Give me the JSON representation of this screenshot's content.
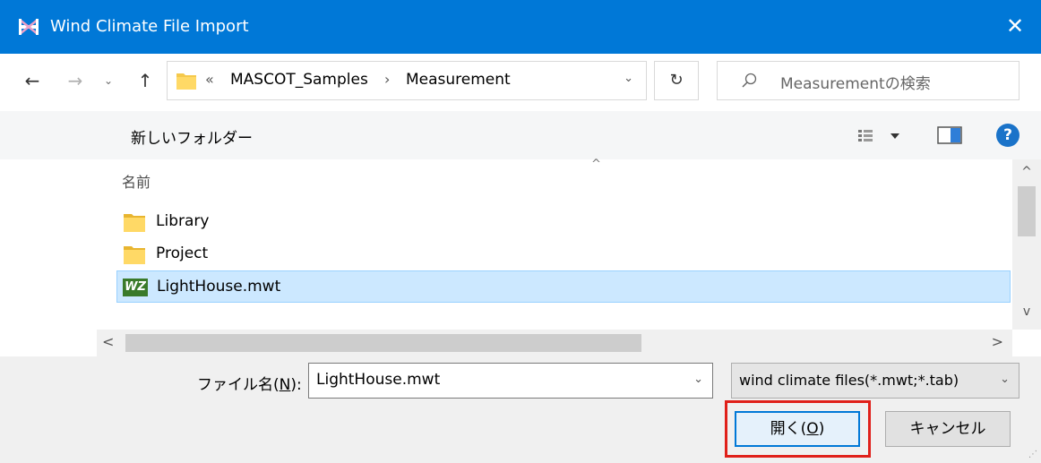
{
  "window": {
    "title": "Wind Climate File Import",
    "close_glyph": "✕"
  },
  "nav": {
    "back_glyph": "←",
    "forward_glyph": "→",
    "recent_glyph": "⌄",
    "up_glyph": "↑"
  },
  "address": {
    "chevron": "«",
    "crumbs": [
      "MASCOT_Samples",
      "Measurement"
    ],
    "separator": "›",
    "dropdown_glyph": "⌄"
  },
  "refresh_glyph": "↻",
  "search": {
    "placeholder": "Measurementの検索"
  },
  "toolbar": {
    "new_folder": "新しいフォルダー",
    "help_glyph": "?"
  },
  "filelist": {
    "sort_glyph": "^",
    "column_name": "名前",
    "items": [
      {
        "name": "Library",
        "type": "folder"
      },
      {
        "name": "Project",
        "type": "folder"
      },
      {
        "name": "LightHouse.mwt",
        "type": "file",
        "icon_text": "WZ",
        "selected": true
      }
    ],
    "scroll_up": "^",
    "scroll_down": "v",
    "scroll_left": "<",
    "scroll_right": ">"
  },
  "bottom": {
    "filename_label_prefix": "ファイル名(",
    "filename_label_key": "N",
    "filename_label_suffix": "):",
    "filename_value": "LightHouse.mwt",
    "filetype_value": "wind climate files(*.mwt;*.tab)",
    "dropdown_glyph": "⌄",
    "open_prefix": "開く(",
    "open_key": "O",
    "open_suffix": ")",
    "cancel": "キャンセル"
  },
  "colors": {
    "titlebar": "#0078d7",
    "selection": "#cce8ff",
    "highlight_box": "#e0201a"
  }
}
